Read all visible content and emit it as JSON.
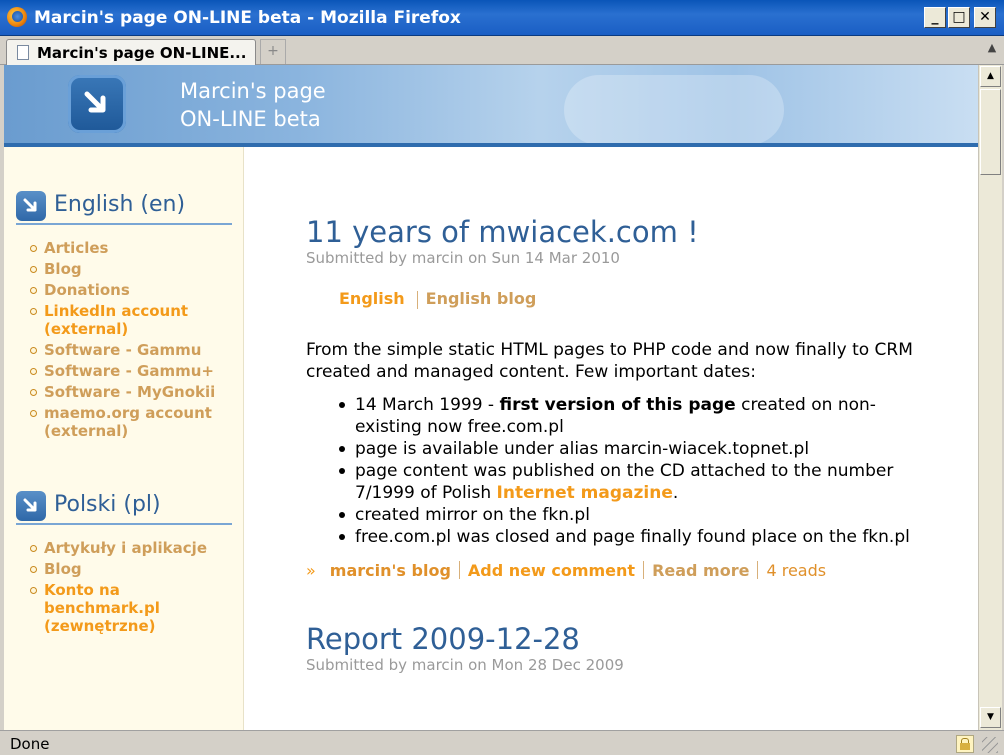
{
  "window": {
    "title": "Marcin's page ON-LINE beta - Mozilla Firefox",
    "minimize": "_",
    "maximize": "□",
    "close": "✕"
  },
  "tabs": [
    {
      "label": "Marcin's page ON-LINE...",
      "icon": "page-icon"
    }
  ],
  "new_tab_symbol": "+",
  "header": {
    "site_name_line1": "Marcin's page",
    "site_name_line2": "ON-LINE beta",
    "logo_icon": "arrow-down-right-icon"
  },
  "sidebar": {
    "blocks": [
      {
        "title": "English (en)",
        "items": [
          {
            "label": "Articles",
            "style": "tan"
          },
          {
            "label": "Blog",
            "style": "tan"
          },
          {
            "label": "Donations",
            "style": "tan"
          },
          {
            "label": "LinkedIn account (external)",
            "style": "orange"
          },
          {
            "label": "Software - Gammu",
            "style": "tan"
          },
          {
            "label": "Software - Gammu+",
            "style": "tan"
          },
          {
            "label": "Software - MyGnokii",
            "style": "tan"
          },
          {
            "label": "maemo.org account (external)",
            "style": "tan"
          }
        ]
      },
      {
        "title": "Polski (pl)",
        "items": [
          {
            "label": "Artykuły i aplikacje",
            "style": "tan"
          },
          {
            "label": "Blog",
            "style": "tan"
          },
          {
            "label": "Konto na benchmark.pl (zewnętrzne)",
            "style": "orange"
          }
        ]
      }
    ]
  },
  "posts": [
    {
      "title": "11 years of mwiacek.com !",
      "submitted": "Submitted by marcin on Sun 14 Mar 2010",
      "terms": [
        "English",
        "English blog"
      ],
      "intro": "From the simple static HTML pages to PHP code and now finally to CRM created and managed content. Few important dates:",
      "list": {
        "item1_prefix": "14 March 1999 - ",
        "item1_bold": "first version of this page",
        "item1_suffix": " created on non-existing now free.com.pl",
        "item2": "page is available under alias marcin-wiacek.topnet.pl",
        "item3_prefix": "page content was published on the CD attached to the number 7/1999 of Polish ",
        "item3_link": "Internet magazine",
        "item3_suffix": ".",
        "item4": "created mirror on the fkn.pl",
        "item5": "free.com.pl was closed and page finally found place on the fkn.pl"
      },
      "links": {
        "raquo": "»",
        "blog": "marcin's blog",
        "comment": "Add new comment",
        "more": "Read more",
        "reads": "4 reads"
      }
    },
    {
      "title": "Report 2009-12-28",
      "submitted": "Submitted by marcin on Mon 28 Dec 2009"
    }
  ],
  "statusbar": {
    "text": "Done"
  },
  "colors": {
    "heading_blue": "#2f5f96",
    "link_orange": "#f39a1a",
    "link_tan": "#cf9e5a",
    "sidebar_bg": "#fffbea"
  }
}
